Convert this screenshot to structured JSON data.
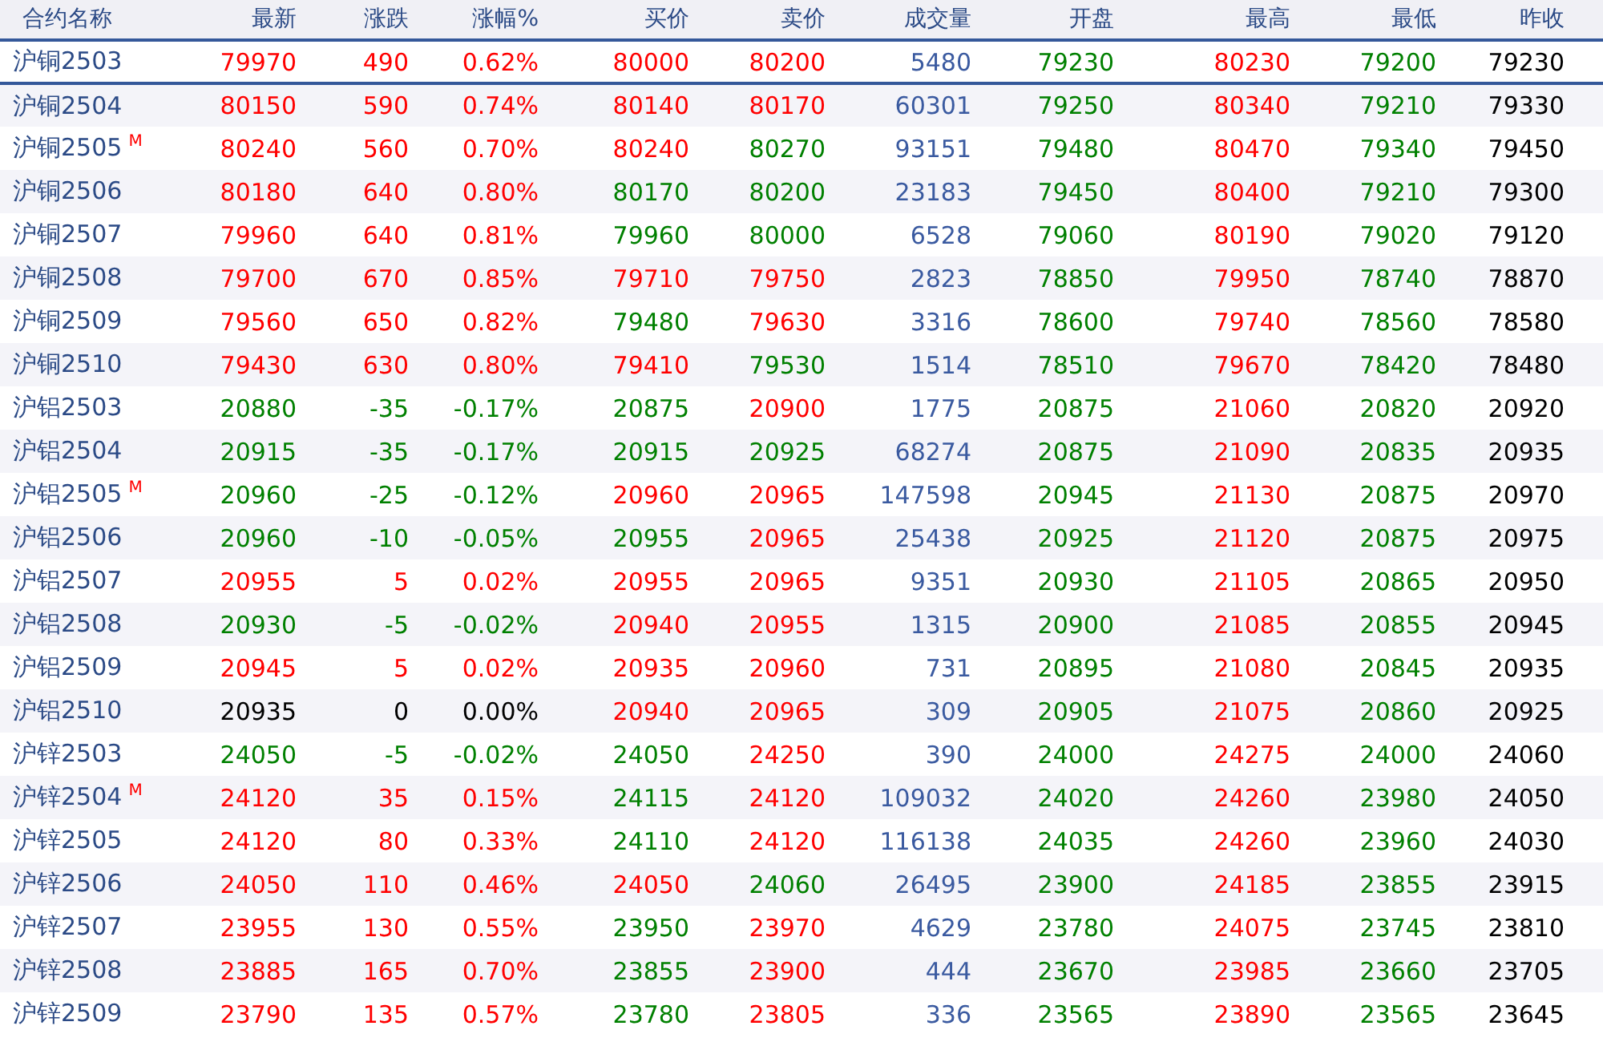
{
  "columns": [
    {
      "label": "合约名称",
      "kind": "name"
    },
    {
      "label": "最新",
      "kind": "price"
    },
    {
      "label": "涨跌",
      "kind": "price"
    },
    {
      "label": "涨幅%",
      "kind": "price"
    },
    {
      "label": "买价",
      "kind": "price"
    },
    {
      "label": "卖价",
      "kind": "price"
    },
    {
      "label": "成交量",
      "kind": "volume"
    },
    {
      "label": "开盘",
      "kind": "price"
    },
    {
      "label": "最高",
      "kind": "price"
    },
    {
      "label": "最低",
      "kind": "price"
    },
    {
      "label": "昨收",
      "kind": "plain"
    }
  ],
  "rows": [
    {
      "name": "沪铜2503",
      "selected": true,
      "cells": [
        {
          "value": "79970",
          "color": "#ff0000"
        },
        {
          "value": "490",
          "color": "#ff0000"
        },
        {
          "value": "0.62%",
          "color": "#ff0000"
        },
        {
          "value": "80000",
          "color": "#ff0000"
        },
        {
          "value": "80200",
          "color": "#ff0000"
        },
        {
          "value": "5480"
        },
        {
          "value": "79230",
          "color": "#008000"
        },
        {
          "value": "80230",
          "color": "#ff0000"
        },
        {
          "value": "79200",
          "color": "#008000"
        },
        {
          "value": "79230"
        }
      ]
    },
    {
      "name": "沪铜2504",
      "selected": false,
      "cells": [
        {
          "value": "80150",
          "color": "#ff0000"
        },
        {
          "value": "590",
          "color": "#ff0000"
        },
        {
          "value": "0.74%",
          "color": "#ff0000"
        },
        {
          "value": "80140",
          "color": "#ff0000"
        },
        {
          "value": "80170",
          "color": "#ff0000"
        },
        {
          "value": "60301"
        },
        {
          "value": "79250",
          "color": "#008000"
        },
        {
          "value": "80340",
          "color": "#ff0000"
        },
        {
          "value": "79210",
          "color": "#008000"
        },
        {
          "value": "79330"
        }
      ]
    },
    {
      "name": "沪铜2505",
      "tag": "M",
      "selected": false,
      "cells": [
        {
          "value": "80240",
          "color": "#ff0000"
        },
        {
          "value": "560",
          "color": "#ff0000"
        },
        {
          "value": "0.70%",
          "color": "#ff0000"
        },
        {
          "value": "80240",
          "color": "#ff0000"
        },
        {
          "value": "80270",
          "color": "#008000"
        },
        {
          "value": "93151"
        },
        {
          "value": "79480",
          "color": "#008000"
        },
        {
          "value": "80470",
          "color": "#ff0000"
        },
        {
          "value": "79340",
          "color": "#008000"
        },
        {
          "value": "79450"
        }
      ]
    },
    {
      "name": "沪铜2506",
      "selected": false,
      "cells": [
        {
          "value": "80180",
          "color": "#ff0000"
        },
        {
          "value": "640",
          "color": "#ff0000"
        },
        {
          "value": "0.80%",
          "color": "#ff0000"
        },
        {
          "value": "80170",
          "color": "#008000"
        },
        {
          "value": "80200",
          "color": "#008000"
        },
        {
          "value": "23183"
        },
        {
          "value": "79450",
          "color": "#008000"
        },
        {
          "value": "80400",
          "color": "#ff0000"
        },
        {
          "value": "79210",
          "color": "#008000"
        },
        {
          "value": "79300"
        }
      ]
    },
    {
      "name": "沪铜2507",
      "selected": false,
      "cells": [
        {
          "value": "79960",
          "color": "#ff0000"
        },
        {
          "value": "640",
          "color": "#ff0000"
        },
        {
          "value": "0.81%",
          "color": "#ff0000"
        },
        {
          "value": "79960",
          "color": "#008000"
        },
        {
          "value": "80000",
          "color": "#008000"
        },
        {
          "value": "6528"
        },
        {
          "value": "79060",
          "color": "#008000"
        },
        {
          "value": "80190",
          "color": "#ff0000"
        },
        {
          "value": "79020",
          "color": "#008000"
        },
        {
          "value": "79120"
        }
      ]
    },
    {
      "name": "沪铜2508",
      "selected": false,
      "cells": [
        {
          "value": "79700",
          "color": "#ff0000"
        },
        {
          "value": "670",
          "color": "#ff0000"
        },
        {
          "value": "0.85%",
          "color": "#ff0000"
        },
        {
          "value": "79710",
          "color": "#ff0000"
        },
        {
          "value": "79750",
          "color": "#ff0000"
        },
        {
          "value": "2823"
        },
        {
          "value": "78850",
          "color": "#008000"
        },
        {
          "value": "79950",
          "color": "#ff0000"
        },
        {
          "value": "78740",
          "color": "#008000"
        },
        {
          "value": "78870"
        }
      ]
    },
    {
      "name": "沪铜2509",
      "selected": false,
      "cells": [
        {
          "value": "79560",
          "color": "#ff0000"
        },
        {
          "value": "650",
          "color": "#ff0000"
        },
        {
          "value": "0.82%",
          "color": "#ff0000"
        },
        {
          "value": "79480",
          "color": "#008000"
        },
        {
          "value": "79630",
          "color": "#ff0000"
        },
        {
          "value": "3316"
        },
        {
          "value": "78600",
          "color": "#008000"
        },
        {
          "value": "79740",
          "color": "#ff0000"
        },
        {
          "value": "78560",
          "color": "#008000"
        },
        {
          "value": "78580"
        }
      ]
    },
    {
      "name": "沪铜2510",
      "selected": false,
      "cells": [
        {
          "value": "79430",
          "color": "#ff0000"
        },
        {
          "value": "630",
          "color": "#ff0000"
        },
        {
          "value": "0.80%",
          "color": "#ff0000"
        },
        {
          "value": "79410",
          "color": "#ff0000"
        },
        {
          "value": "79530",
          "color": "#008000"
        },
        {
          "value": "1514"
        },
        {
          "value": "78510",
          "color": "#008000"
        },
        {
          "value": "79670",
          "color": "#ff0000"
        },
        {
          "value": "78420",
          "color": "#008000"
        },
        {
          "value": "78480"
        }
      ]
    },
    {
      "name": "沪铝2503",
      "selected": false,
      "cells": [
        {
          "value": "20880",
          "color": "#008000"
        },
        {
          "value": "-35",
          "color": "#008000"
        },
        {
          "value": "-0.17%",
          "color": "#008000"
        },
        {
          "value": "20875",
          "color": "#008000"
        },
        {
          "value": "20900",
          "color": "#ff0000"
        },
        {
          "value": "1775"
        },
        {
          "value": "20875",
          "color": "#008000"
        },
        {
          "value": "21060",
          "color": "#ff0000"
        },
        {
          "value": "20820",
          "color": "#008000"
        },
        {
          "value": "20920"
        }
      ]
    },
    {
      "name": "沪铝2504",
      "selected": false,
      "cells": [
        {
          "value": "20915",
          "color": "#008000"
        },
        {
          "value": "-35",
          "color": "#008000"
        },
        {
          "value": "-0.17%",
          "color": "#008000"
        },
        {
          "value": "20915",
          "color": "#008000"
        },
        {
          "value": "20925",
          "color": "#008000"
        },
        {
          "value": "68274"
        },
        {
          "value": "20875",
          "color": "#008000"
        },
        {
          "value": "21090",
          "color": "#ff0000"
        },
        {
          "value": "20835",
          "color": "#008000"
        },
        {
          "value": "20935"
        }
      ]
    },
    {
      "name": "沪铝2505",
      "tag": "M",
      "selected": false,
      "cells": [
        {
          "value": "20960",
          "color": "#008000"
        },
        {
          "value": "-25",
          "color": "#008000"
        },
        {
          "value": "-0.12%",
          "color": "#008000"
        },
        {
          "value": "20960",
          "color": "#ff0000"
        },
        {
          "value": "20965",
          "color": "#ff0000"
        },
        {
          "value": "147598"
        },
        {
          "value": "20945",
          "color": "#008000"
        },
        {
          "value": "21130",
          "color": "#ff0000"
        },
        {
          "value": "20875",
          "color": "#008000"
        },
        {
          "value": "20970"
        }
      ]
    },
    {
      "name": "沪铝2506",
      "selected": false,
      "cells": [
        {
          "value": "20960",
          "color": "#008000"
        },
        {
          "value": "-10",
          "color": "#008000"
        },
        {
          "value": "-0.05%",
          "color": "#008000"
        },
        {
          "value": "20955",
          "color": "#008000"
        },
        {
          "value": "20965",
          "color": "#ff0000"
        },
        {
          "value": "25438"
        },
        {
          "value": "20925",
          "color": "#008000"
        },
        {
          "value": "21120",
          "color": "#ff0000"
        },
        {
          "value": "20875",
          "color": "#008000"
        },
        {
          "value": "20975"
        }
      ]
    },
    {
      "name": "沪铝2507",
      "selected": false,
      "cells": [
        {
          "value": "20955",
          "color": "#ff0000"
        },
        {
          "value": "5",
          "color": "#ff0000"
        },
        {
          "value": "0.02%",
          "color": "#ff0000"
        },
        {
          "value": "20955",
          "color": "#ff0000"
        },
        {
          "value": "20965",
          "color": "#ff0000"
        },
        {
          "value": "9351"
        },
        {
          "value": "20930",
          "color": "#008000"
        },
        {
          "value": "21105",
          "color": "#ff0000"
        },
        {
          "value": "20865",
          "color": "#008000"
        },
        {
          "value": "20950"
        }
      ]
    },
    {
      "name": "沪铝2508",
      "selected": false,
      "cells": [
        {
          "value": "20930",
          "color": "#008000"
        },
        {
          "value": "-5",
          "color": "#008000"
        },
        {
          "value": "-0.02%",
          "color": "#008000"
        },
        {
          "value": "20940",
          "color": "#ff0000"
        },
        {
          "value": "20955",
          "color": "#ff0000"
        },
        {
          "value": "1315"
        },
        {
          "value": "20900",
          "color": "#008000"
        },
        {
          "value": "21085",
          "color": "#ff0000"
        },
        {
          "value": "20855",
          "color": "#008000"
        },
        {
          "value": "20945"
        }
      ]
    },
    {
      "name": "沪铝2509",
      "selected": false,
      "cells": [
        {
          "value": "20945",
          "color": "#ff0000"
        },
        {
          "value": "5",
          "color": "#ff0000"
        },
        {
          "value": "0.02%",
          "color": "#ff0000"
        },
        {
          "value": "20935",
          "color": "#ff0000"
        },
        {
          "value": "20960",
          "color": "#ff0000"
        },
        {
          "value": "731"
        },
        {
          "value": "20895",
          "color": "#008000"
        },
        {
          "value": "21080",
          "color": "#ff0000"
        },
        {
          "value": "20845",
          "color": "#008000"
        },
        {
          "value": "20935"
        }
      ]
    },
    {
      "name": "沪铝2510",
      "selected": false,
      "cells": [
        {
          "value": "20935",
          "color": "#000000"
        },
        {
          "value": "0",
          "color": "#000000"
        },
        {
          "value": "0.00%",
          "color": "#000000"
        },
        {
          "value": "20940",
          "color": "#ff0000"
        },
        {
          "value": "20965",
          "color": "#ff0000"
        },
        {
          "value": "309"
        },
        {
          "value": "20905",
          "color": "#008000"
        },
        {
          "value": "21075",
          "color": "#ff0000"
        },
        {
          "value": "20860",
          "color": "#008000"
        },
        {
          "value": "20925"
        }
      ]
    },
    {
      "name": "沪锌2503",
      "selected": false,
      "cells": [
        {
          "value": "24050",
          "color": "#008000"
        },
        {
          "value": "-5",
          "color": "#008000"
        },
        {
          "value": "-0.02%",
          "color": "#008000"
        },
        {
          "value": "24050",
          "color": "#008000"
        },
        {
          "value": "24250",
          "color": "#ff0000"
        },
        {
          "value": "390"
        },
        {
          "value": "24000",
          "color": "#008000"
        },
        {
          "value": "24275",
          "color": "#ff0000"
        },
        {
          "value": "24000",
          "color": "#008000"
        },
        {
          "value": "24060"
        }
      ]
    },
    {
      "name": "沪锌2504",
      "tag": "M",
      "selected": false,
      "cells": [
        {
          "value": "24120",
          "color": "#ff0000"
        },
        {
          "value": "35",
          "color": "#ff0000"
        },
        {
          "value": "0.15%",
          "color": "#ff0000"
        },
        {
          "value": "24115",
          "color": "#008000"
        },
        {
          "value": "24120",
          "color": "#ff0000"
        },
        {
          "value": "109032"
        },
        {
          "value": "24020",
          "color": "#008000"
        },
        {
          "value": "24260",
          "color": "#ff0000"
        },
        {
          "value": "23980",
          "color": "#008000"
        },
        {
          "value": "24050"
        }
      ]
    },
    {
      "name": "沪锌2505",
      "selected": false,
      "cells": [
        {
          "value": "24120",
          "color": "#ff0000"
        },
        {
          "value": "80",
          "color": "#ff0000"
        },
        {
          "value": "0.33%",
          "color": "#ff0000"
        },
        {
          "value": "24110",
          "color": "#008000"
        },
        {
          "value": "24120",
          "color": "#ff0000"
        },
        {
          "value": "116138"
        },
        {
          "value": "24035",
          "color": "#008000"
        },
        {
          "value": "24260",
          "color": "#ff0000"
        },
        {
          "value": "23960",
          "color": "#008000"
        },
        {
          "value": "24030"
        }
      ]
    },
    {
      "name": "沪锌2506",
      "selected": false,
      "cells": [
        {
          "value": "24050",
          "color": "#ff0000"
        },
        {
          "value": "110",
          "color": "#ff0000"
        },
        {
          "value": "0.46%",
          "color": "#ff0000"
        },
        {
          "value": "24050",
          "color": "#ff0000"
        },
        {
          "value": "24060",
          "color": "#008000"
        },
        {
          "value": "26495"
        },
        {
          "value": "23900",
          "color": "#008000"
        },
        {
          "value": "24185",
          "color": "#ff0000"
        },
        {
          "value": "23855",
          "color": "#008000"
        },
        {
          "value": "23915"
        }
      ]
    },
    {
      "name": "沪锌2507",
      "selected": false,
      "cells": [
        {
          "value": "23955",
          "color": "#ff0000"
        },
        {
          "value": "130",
          "color": "#ff0000"
        },
        {
          "value": "0.55%",
          "color": "#ff0000"
        },
        {
          "value": "23950",
          "color": "#008000"
        },
        {
          "value": "23970",
          "color": "#ff0000"
        },
        {
          "value": "4629"
        },
        {
          "value": "23780",
          "color": "#008000"
        },
        {
          "value": "24075",
          "color": "#ff0000"
        },
        {
          "value": "23745",
          "color": "#008000"
        },
        {
          "value": "23810"
        }
      ]
    },
    {
      "name": "沪锌2508",
      "selected": false,
      "cells": [
        {
          "value": "23885",
          "color": "#ff0000"
        },
        {
          "value": "165",
          "color": "#ff0000"
        },
        {
          "value": "0.70%",
          "color": "#ff0000"
        },
        {
          "value": "23855",
          "color": "#008000"
        },
        {
          "value": "23900",
          "color": "#ff0000"
        },
        {
          "value": "444"
        },
        {
          "value": "23670",
          "color": "#008000"
        },
        {
          "value": "23985",
          "color": "#ff0000"
        },
        {
          "value": "23660",
          "color": "#008000"
        },
        {
          "value": "23705"
        }
      ]
    },
    {
      "name": "沪锌2509",
      "selected": false,
      "cells": [
        {
          "value": "23790",
          "color": "#ff0000"
        },
        {
          "value": "135",
          "color": "#ff0000"
        },
        {
          "value": "0.57%",
          "color": "#ff0000"
        },
        {
          "value": "23780",
          "color": "#008000"
        },
        {
          "value": "23805",
          "color": "#ff0000"
        },
        {
          "value": "336"
        },
        {
          "value": "23565",
          "color": "#008000"
        },
        {
          "value": "23890",
          "color": "#ff0000"
        },
        {
          "value": "23565",
          "color": "#008000"
        },
        {
          "value": "23645"
        }
      ]
    }
  ]
}
